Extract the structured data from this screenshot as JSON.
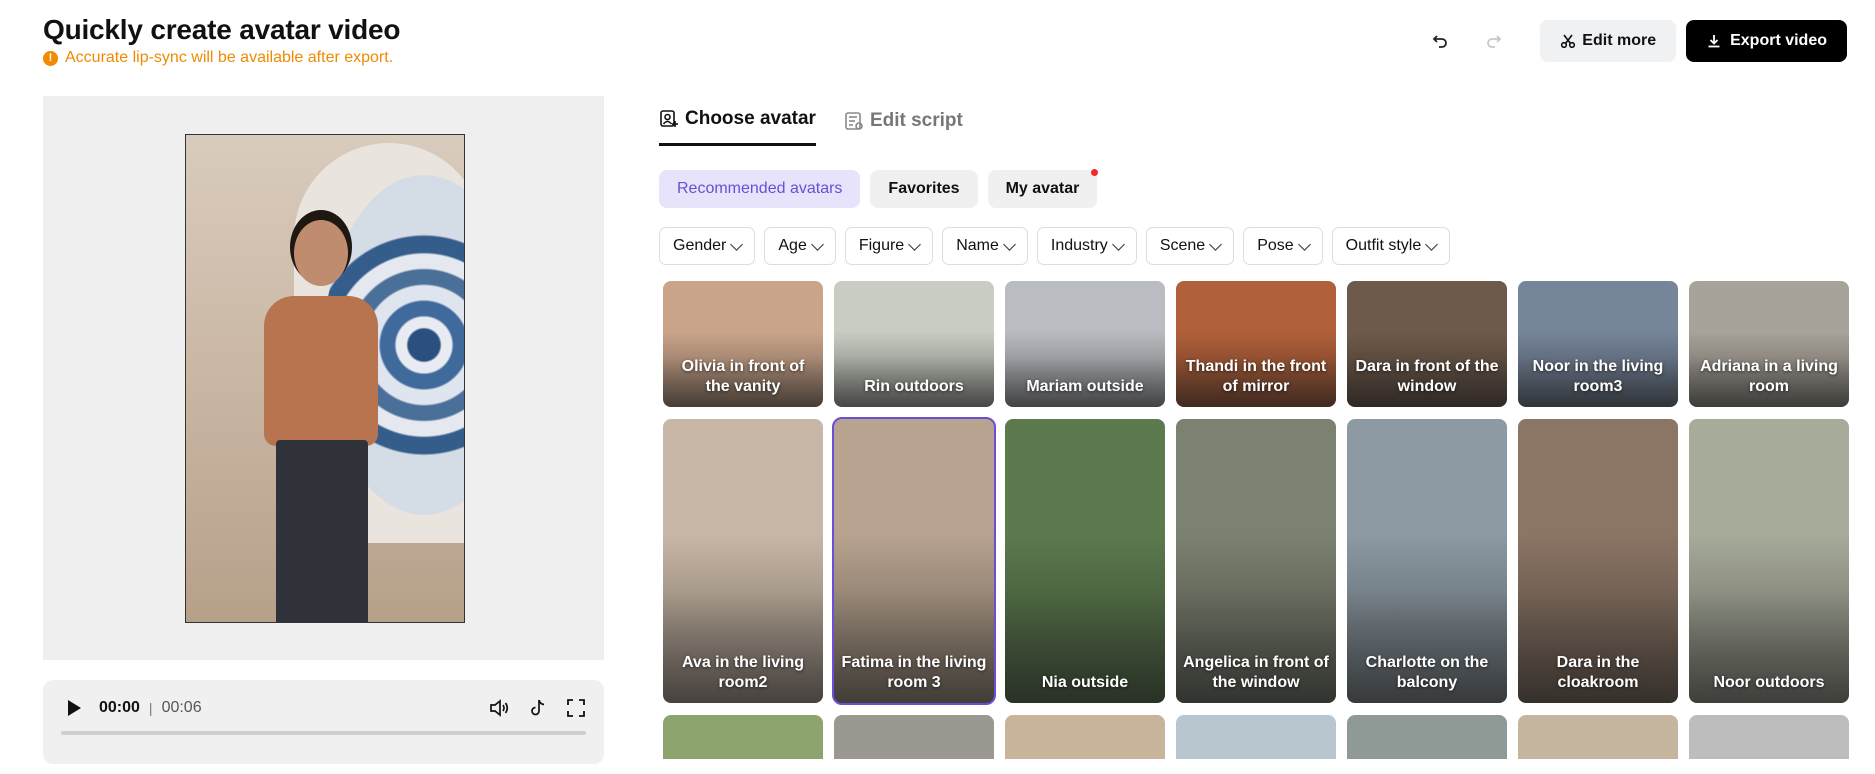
{
  "header": {
    "title": "Quickly create avatar video",
    "warning": "Accurate lip-sync will be available after export.",
    "warning_icon": "!",
    "edit_more": "Edit more",
    "export": "Export video"
  },
  "player": {
    "current_time": "00:00",
    "separator": "|",
    "total_time": "00:06",
    "progress_fraction": 0
  },
  "tabs": [
    {
      "label": "Choose avatar",
      "active": true
    },
    {
      "label": "Edit script",
      "active": false
    }
  ],
  "categories": [
    {
      "label": "Recommended avatars",
      "active": true
    },
    {
      "label": "Favorites",
      "active": false
    },
    {
      "label": "My avatar",
      "active": false,
      "has_dot": true
    }
  ],
  "filters": [
    "Gender",
    "Age",
    "Figure",
    "Name",
    "Industry",
    "Scene",
    "Pose",
    "Outfit style"
  ],
  "avatars_row1": [
    {
      "label": "Olivia in front of the vanity",
      "color": "#c9a48a"
    },
    {
      "label": "Rin outdoors",
      "color": "#c8ccc2"
    },
    {
      "label": "Mariam outside",
      "color": "#b9bcc0"
    },
    {
      "label": "Thandi in the front of mirror",
      "color": "#b0603a"
    },
    {
      "label": "Dara in front of the window",
      "color": "#6e5a4a"
    },
    {
      "label": "Noor in the living room3",
      "color": "#76859a"
    },
    {
      "label": "Adriana in a living room",
      "color": "#a8a39a"
    }
  ],
  "avatars_row2": [
    {
      "label": "Ava in the living room2",
      "color": "#c8b7a6",
      "selected": false
    },
    {
      "label": "Fatima in the living room 3",
      "color": "#b7a38f",
      "selected": true
    },
    {
      "label": "Nia outside",
      "color": "#5c7a4e",
      "selected": false
    },
    {
      "label": "Angelica in front of the window",
      "color": "#7c8271",
      "selected": false
    },
    {
      "label": "Charlotte on the balcony",
      "color": "#8d9aa3",
      "selected": false
    },
    {
      "label": "Dara in the cloakroom",
      "color": "#8b7565",
      "selected": false
    },
    {
      "label": "Noor outdoors",
      "color": "#a7ab9a",
      "selected": false
    }
  ],
  "avatars_row3": [
    {
      "color": "#8ea46f"
    },
    {
      "color": "#9b9891"
    },
    {
      "color": "#c7b49b"
    },
    {
      "color": "#b8c6cf"
    },
    {
      "color": "#8f9a97"
    },
    {
      "color": "#c6b59e"
    },
    {
      "color": "#bdbdbd"
    }
  ]
}
